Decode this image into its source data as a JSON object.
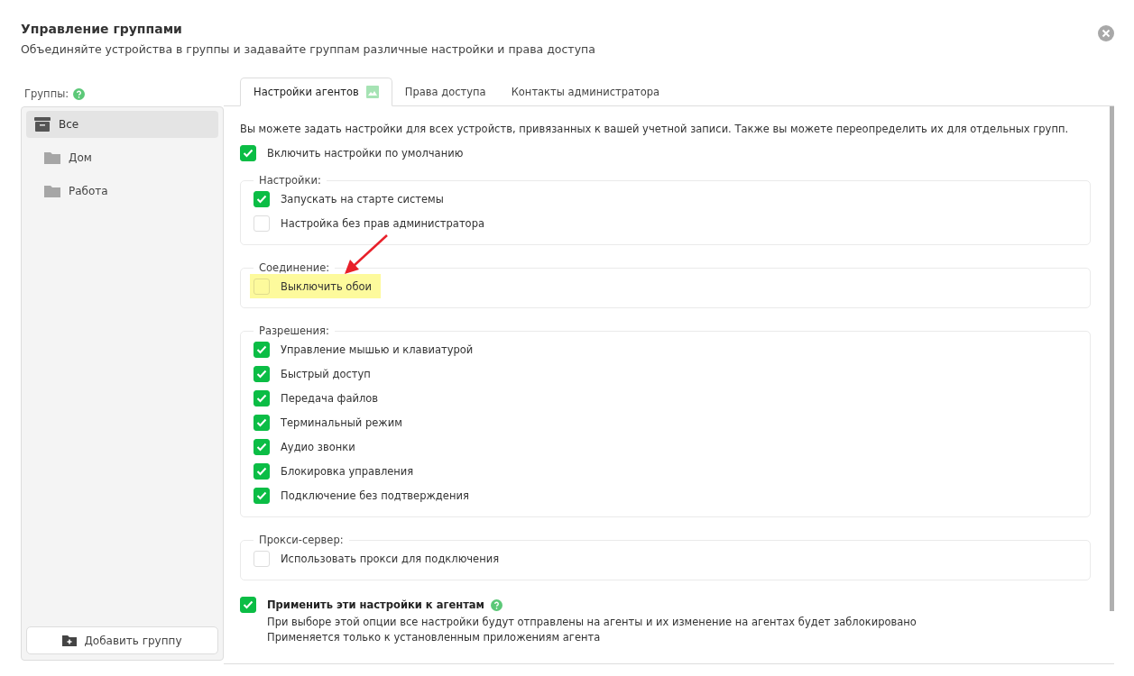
{
  "title": "Управление группами",
  "subtitle": "Объединяйте устройства в группы и задавайте группам различные настройки и права доступа",
  "groups": {
    "label": "Группы:",
    "items": [
      {
        "name": "Все",
        "kind": "archive",
        "selected": true
      },
      {
        "name": "Дом",
        "kind": "folder",
        "selected": false
      },
      {
        "name": "Работа",
        "kind": "folder",
        "selected": false
      }
    ],
    "add_button": "Добавить группу"
  },
  "tabs": [
    {
      "label": "Настройки агентов",
      "selected": true,
      "badge": true
    },
    {
      "label": "Права доступа",
      "selected": false,
      "badge": false
    },
    {
      "label": "Контакты администратора",
      "selected": false,
      "badge": false
    }
  ],
  "intro": "Вы можете задать настройки для всех устройств, привязанных к вашей учетной записи. Также вы можете переопределить их для отдельных групп.",
  "default_toggle": {
    "label": "Включить настройки по умолчанию",
    "checked": true
  },
  "sections": [
    {
      "title": "Настройки:",
      "options": [
        {
          "label": "Запускать на старте системы",
          "checked": true,
          "highlighted": false
        },
        {
          "label": "Настройка без прав администратора",
          "checked": false,
          "highlighted": false
        }
      ]
    },
    {
      "title": "Соединение:",
      "options": [
        {
          "label": "Выключить обои",
          "checked": false,
          "highlighted": true
        }
      ]
    },
    {
      "title": "Разрешения:",
      "options": [
        {
          "label": "Управление мышью и клавиатурой",
          "checked": true,
          "highlighted": false
        },
        {
          "label": "Быстрый доступ",
          "checked": true,
          "highlighted": false
        },
        {
          "label": "Передача файлов",
          "checked": true,
          "highlighted": false
        },
        {
          "label": "Терминальный режим",
          "checked": true,
          "highlighted": false
        },
        {
          "label": "Аудио звонки",
          "checked": true,
          "highlighted": false
        },
        {
          "label": "Блокировка управления",
          "checked": true,
          "highlighted": false
        },
        {
          "label": "Подключение без подтверждения",
          "checked": true,
          "highlighted": false
        }
      ]
    },
    {
      "title": "Прокси-сервер:",
      "options": [
        {
          "label": "Использовать прокси для подключения",
          "checked": false,
          "highlighted": false
        }
      ]
    }
  ],
  "apply": {
    "label": "Применить эти настройки к агентам",
    "checked": true,
    "notes": [
      "При выборе этой опции все настройки будут отправлены на агенты и их изменение на агентах будет заблокировано",
      "Применяется только к установленным приложениям агента"
    ]
  }
}
